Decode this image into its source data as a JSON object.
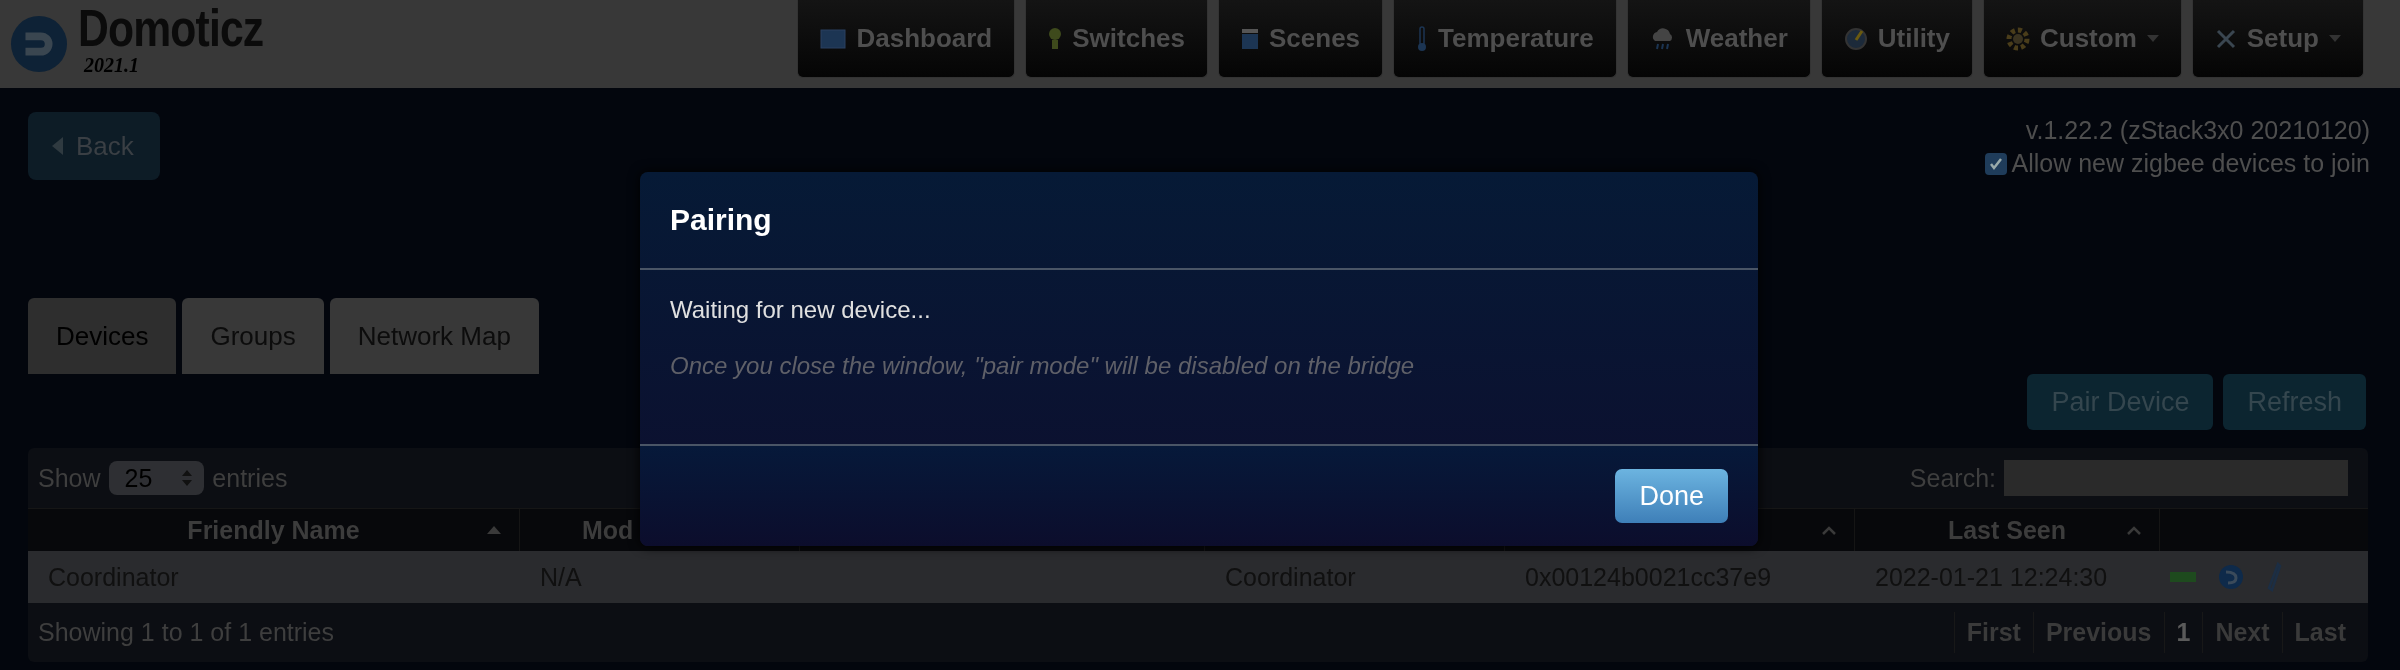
{
  "app": {
    "name": "Domoticz",
    "version": "2021.1"
  },
  "nav": [
    {
      "label": "Dashboard",
      "dropdown": false
    },
    {
      "label": "Switches",
      "dropdown": false
    },
    {
      "label": "Scenes",
      "dropdown": false
    },
    {
      "label": "Temperature",
      "dropdown": false
    },
    {
      "label": "Weather",
      "dropdown": false
    },
    {
      "label": "Utility",
      "dropdown": false
    },
    {
      "label": "Custom",
      "dropdown": true
    },
    {
      "label": "Setup",
      "dropdown": true
    }
  ],
  "back_button": "Back",
  "plugin_version": "v.1.22.2 (zStack3x0 20210120)",
  "allow_join": {
    "label": "Allow new zigbee devices to join",
    "checked": true
  },
  "tabs": [
    {
      "label": "Devices",
      "selected": true
    },
    {
      "label": "Groups",
      "selected": false
    },
    {
      "label": "Network Map",
      "selected": false
    }
  ],
  "actions": [
    "Pair Device",
    "Refresh"
  ],
  "table": {
    "show_label": "Show",
    "page_size": "25",
    "entries_label": "entries",
    "search_label": "Search:",
    "columns": [
      {
        "label": "Friendly Name",
        "sorted": true
      },
      {
        "label": "Mod"
      },
      {},
      {},
      {
        "sorted": false
      },
      {
        "label": "Last Seen",
        "sorted": false
      }
    ],
    "rows": [
      {
        "cells": [
          "Coordinator",
          "N/A",
          "",
          "Coordinator",
          "0x00124b0021cc37e9",
          "2022-01-21 12:24:30"
        ]
      }
    ],
    "info": "Showing 1 to 1 of 1 entries",
    "pagination": [
      {
        "label": "First",
        "selected": false
      },
      {
        "label": "Previous",
        "selected": false
      },
      {
        "label": "1",
        "selected": true
      },
      {
        "label": "Next",
        "selected": false
      },
      {
        "label": "Last",
        "selected": false
      }
    ]
  },
  "dialog": {
    "title": "Pairing",
    "message": "Waiting for new device...",
    "note": "Once you close the window, \"pair mode\" will be disabled on the bridge",
    "button": "Done"
  }
}
